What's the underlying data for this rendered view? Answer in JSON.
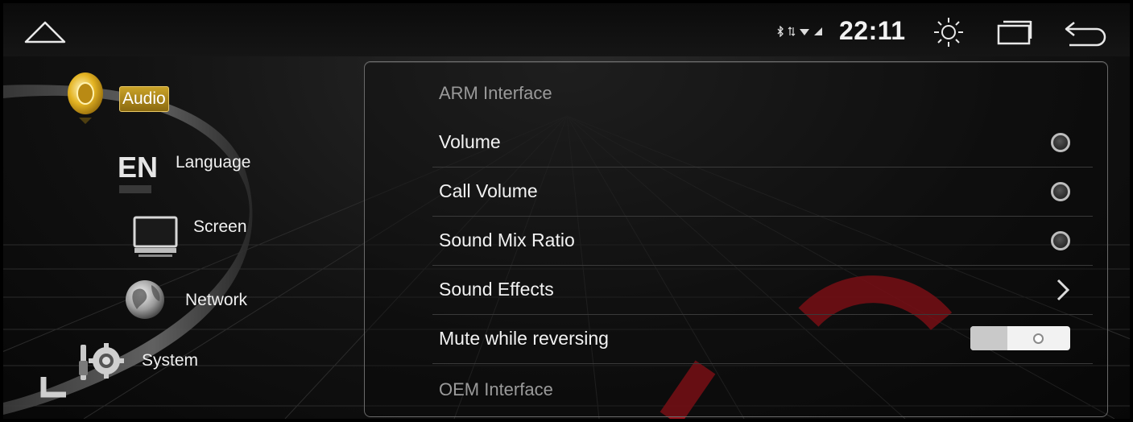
{
  "status_bar": {
    "time": "22:11",
    "icons": [
      "bluetooth-icon",
      "data-arrows-icon",
      "wifi-icon",
      "signal-icon"
    ],
    "buttons": [
      "home-icon",
      "brightness-icon",
      "recents-icon",
      "back-icon"
    ]
  },
  "sidebar": {
    "items": [
      {
        "label": "Audio",
        "icon": "speaker-icon",
        "active": true
      },
      {
        "label": "Language",
        "icon": "language-en-icon",
        "active": false
      },
      {
        "label": "Screen",
        "icon": "monitor-icon",
        "active": false
      },
      {
        "label": "Network",
        "icon": "globe-icon",
        "active": false
      },
      {
        "label": "System",
        "icon": "tools-gear-icon",
        "active": false
      }
    ]
  },
  "panel": {
    "section_arm": "ARM Interface",
    "rows": [
      {
        "label": "Volume",
        "control": "radio"
      },
      {
        "label": "Call Volume",
        "control": "radio"
      },
      {
        "label": "Sound Mix Ratio",
        "control": "radio"
      },
      {
        "label": "Sound Effects",
        "control": "chevron"
      },
      {
        "label": "Mute while reversing",
        "control": "toggle",
        "value": "off"
      }
    ],
    "section_oem": "OEM Interface"
  },
  "colors": {
    "accent_gold": "#c9a227",
    "watermark_red": "#c0101a",
    "background": "#121212"
  }
}
